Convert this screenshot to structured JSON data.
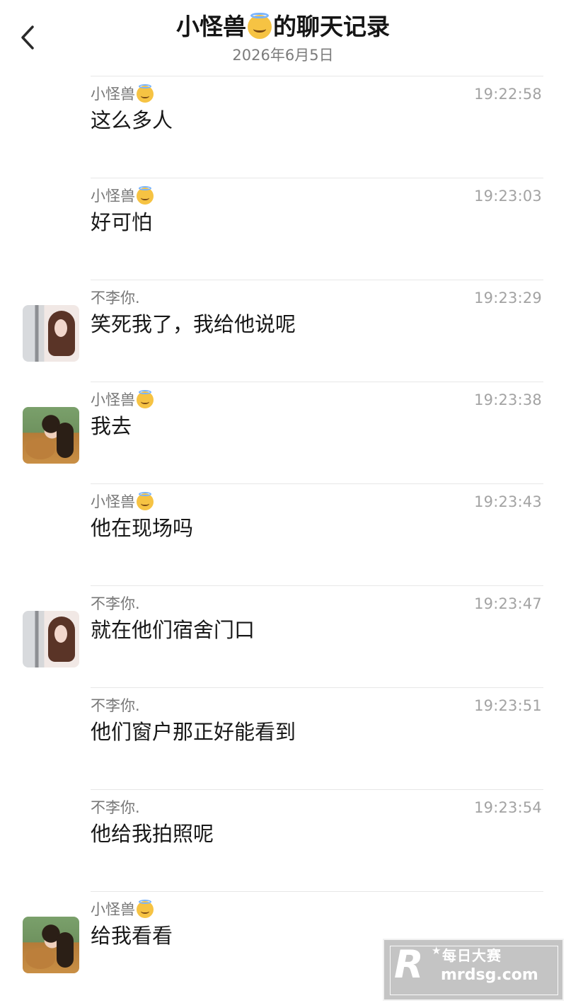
{
  "header": {
    "back_icon": "chevron-left-icon",
    "title_prefix": "小怪兽",
    "title_suffix": "的聊天记录",
    "emoji_icon": "smiling-face-with-halo-icon",
    "date": "2026年6月5日"
  },
  "messages": [
    {
      "sender": "小怪兽",
      "sender_emoji": "smiling-face-with-halo-icon",
      "time": "19:22:58",
      "text": "这么多人",
      "avatar": ""
    },
    {
      "sender": "小怪兽",
      "sender_emoji": "smiling-face-with-halo-icon",
      "time": "19:23:03",
      "text": "好可怕",
      "avatar": ""
    },
    {
      "sender": "不李你.",
      "time": "19:23:29",
      "text": "笑死我了，我给他说呢",
      "avatar": "buli"
    },
    {
      "sender": "小怪兽",
      "sender_emoji": "smiling-face-with-halo-icon",
      "time": "19:23:38",
      "text": "我去",
      "avatar": "monster"
    },
    {
      "sender": "小怪兽",
      "sender_emoji": "smiling-face-with-halo-icon",
      "time": "19:23:43",
      "text": "他在现场吗",
      "avatar": ""
    },
    {
      "sender": "不李你.",
      "time": "19:23:47",
      "text": "就在他们宿舍门口",
      "avatar": "buli"
    },
    {
      "sender": "不李你.",
      "time": "19:23:51",
      "text": "他们窗户那正好能看到",
      "avatar": ""
    },
    {
      "sender": "不李你.",
      "time": "19:23:54",
      "text": "他给我拍照呢",
      "avatar": ""
    },
    {
      "sender": "小怪兽",
      "sender_emoji": "smiling-face-with-halo-icon",
      "time": "",
      "text": "给我看看",
      "avatar": "monster"
    }
  ],
  "watermark": {
    "logo": "R",
    "line1": "每日大赛",
    "line2": "mrdsg.com"
  }
}
